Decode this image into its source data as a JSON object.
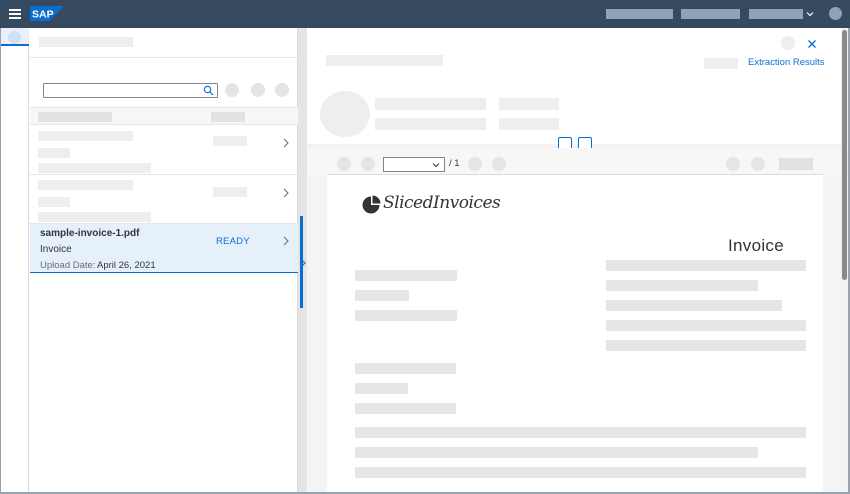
{
  "shell": {
    "logo_text": "SAP",
    "brand_color": "#354a5f",
    "logo_color": "#0a6ed1",
    "menu_icon": "hamburger-menu-icon",
    "user_icon": "avatar-icon"
  },
  "master": {
    "search": {
      "value": "",
      "placeholder": "",
      "icon": "search-icon"
    },
    "selected_document": {
      "file_name": "sample-invoice-1.pdf",
      "document_type": "Invoice",
      "upload_date_label": "Upload Date:",
      "upload_date": "April 26, 2021",
      "status": "READY"
    }
  },
  "detail": {
    "close_icon": "close-icon",
    "extraction_link": "Extraction Results",
    "viewer": {
      "page_total": "/ 1"
    },
    "document": {
      "brand_name": "SlicedInvoices",
      "heading": "Invoice"
    }
  },
  "colors": {
    "accent": "#0a6ed1",
    "selection": "#e5f0fa",
    "text": "#32363a"
  }
}
